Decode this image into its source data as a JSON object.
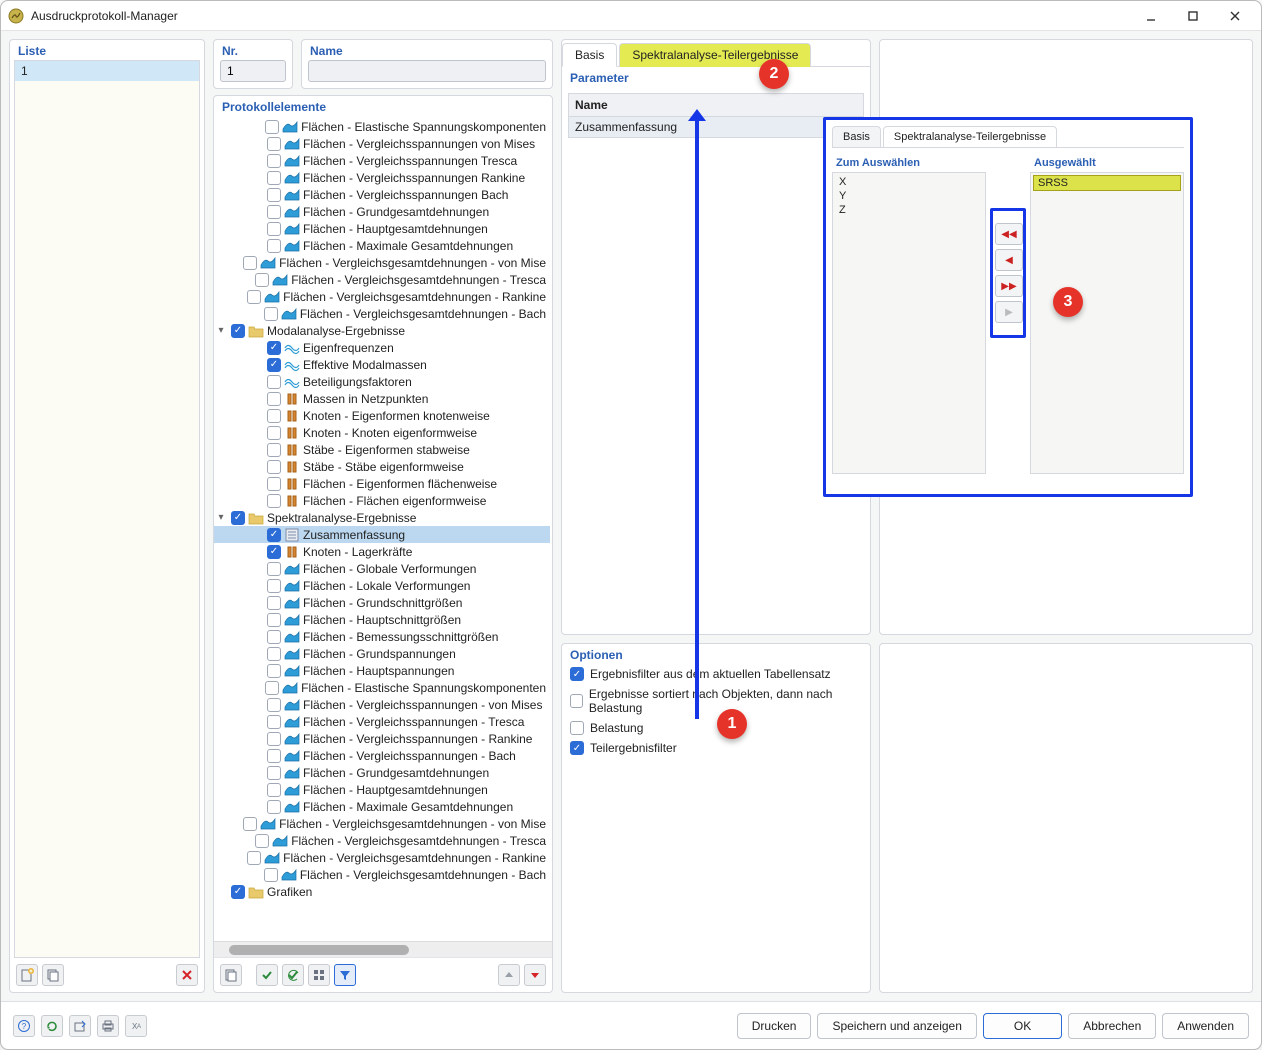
{
  "window": {
    "title": "Ausdruckprotokoll-Manager"
  },
  "leftPanel": {
    "header": "Liste",
    "items": [
      "1"
    ]
  },
  "mid": {
    "nr": {
      "label": "Nr.",
      "value": "1"
    },
    "name": {
      "label": "Name",
      "value": ""
    },
    "protokollHeader": "Protokollelemente"
  },
  "tree": [
    {
      "ind": 2,
      "chk": false,
      "icon": "surf",
      "label": "Flächen - Elastische Spannungskomponenten"
    },
    {
      "ind": 2,
      "chk": false,
      "icon": "surf",
      "label": "Flächen - Vergleichsspannungen von Mises"
    },
    {
      "ind": 2,
      "chk": false,
      "icon": "surf",
      "label": "Flächen - Vergleichsspannungen Tresca"
    },
    {
      "ind": 2,
      "chk": false,
      "icon": "surf",
      "label": "Flächen - Vergleichsspannungen Rankine"
    },
    {
      "ind": 2,
      "chk": false,
      "icon": "surf",
      "label": "Flächen - Vergleichsspannungen Bach"
    },
    {
      "ind": 2,
      "chk": false,
      "icon": "surf",
      "label": "Flächen - Grundgesamtdehnungen"
    },
    {
      "ind": 2,
      "chk": false,
      "icon": "surf",
      "label": "Flächen - Hauptgesamtdehnungen"
    },
    {
      "ind": 2,
      "chk": false,
      "icon": "surf",
      "label": "Flächen - Maximale Gesamtdehnungen"
    },
    {
      "ind": 2,
      "chk": false,
      "icon": "surf",
      "label": "Flächen - Vergleichsgesamtdehnungen - von Mise"
    },
    {
      "ind": 2,
      "chk": false,
      "icon": "surf",
      "label": "Flächen - Vergleichsgesamtdehnungen - Tresca"
    },
    {
      "ind": 2,
      "chk": false,
      "icon": "surf",
      "label": "Flächen - Vergleichsgesamtdehnungen - Rankine"
    },
    {
      "ind": 2,
      "chk": false,
      "icon": "surf",
      "label": "Flächen - Vergleichsgesamtdehnungen - Bach"
    },
    {
      "ind": 0,
      "exp": "open",
      "chk": true,
      "icon": "folder",
      "label": "Modalanalyse-Ergebnisse"
    },
    {
      "ind": 2,
      "chk": true,
      "icon": "wave",
      "label": "Eigenfrequenzen"
    },
    {
      "ind": 2,
      "chk": true,
      "icon": "wave",
      "label": "Effektive Modalmassen"
    },
    {
      "ind": 2,
      "chk": false,
      "icon": "wave",
      "label": "Beteiligungsfaktoren"
    },
    {
      "ind": 2,
      "chk": false,
      "icon": "node",
      "label": "Massen in Netzpunkten"
    },
    {
      "ind": 2,
      "chk": false,
      "icon": "node",
      "label": "Knoten - Eigenformen knotenweise"
    },
    {
      "ind": 2,
      "chk": false,
      "icon": "node",
      "label": "Knoten - Knoten eigenformweise"
    },
    {
      "ind": 2,
      "chk": false,
      "icon": "node",
      "label": "Stäbe - Eigenformen stabweise"
    },
    {
      "ind": 2,
      "chk": false,
      "icon": "node",
      "label": "Stäbe - Stäbe eigenformweise"
    },
    {
      "ind": 2,
      "chk": false,
      "icon": "node",
      "label": "Flächen - Eigenformen flächenweise"
    },
    {
      "ind": 2,
      "chk": false,
      "icon": "node",
      "label": "Flächen - Flächen eigenformweise"
    },
    {
      "ind": 0,
      "exp": "open",
      "chk": true,
      "icon": "folder",
      "label": "Spektralanalyse-Ergebnisse"
    },
    {
      "ind": 2,
      "chk": true,
      "icon": "page",
      "label": "Zusammenfassung",
      "sel": true
    },
    {
      "ind": 2,
      "chk": true,
      "icon": "node",
      "label": "Knoten - Lagerkräfte"
    },
    {
      "ind": 2,
      "chk": false,
      "icon": "surf",
      "label": "Flächen - Globale Verformungen"
    },
    {
      "ind": 2,
      "chk": false,
      "icon": "surf",
      "label": "Flächen - Lokale Verformungen"
    },
    {
      "ind": 2,
      "chk": false,
      "icon": "surf",
      "label": "Flächen - Grundschnittgrößen"
    },
    {
      "ind": 2,
      "chk": false,
      "icon": "surf",
      "label": "Flächen - Hauptschnittgrößen"
    },
    {
      "ind": 2,
      "chk": false,
      "icon": "surf",
      "label": "Flächen - Bemessungsschnittgrößen"
    },
    {
      "ind": 2,
      "chk": false,
      "icon": "surf",
      "label": "Flächen - Grundspannungen"
    },
    {
      "ind": 2,
      "chk": false,
      "icon": "surf",
      "label": "Flächen - Hauptspannungen"
    },
    {
      "ind": 2,
      "chk": false,
      "icon": "surf",
      "label": "Flächen - Elastische Spannungskomponenten"
    },
    {
      "ind": 2,
      "chk": false,
      "icon": "surf",
      "label": "Flächen - Vergleichsspannungen - von Mises"
    },
    {
      "ind": 2,
      "chk": false,
      "icon": "surf",
      "label": "Flächen - Vergleichsspannungen - Tresca"
    },
    {
      "ind": 2,
      "chk": false,
      "icon": "surf",
      "label": "Flächen - Vergleichsspannungen - Rankine"
    },
    {
      "ind": 2,
      "chk": false,
      "icon": "surf",
      "label": "Flächen - Vergleichsspannungen - Bach"
    },
    {
      "ind": 2,
      "chk": false,
      "icon": "surf",
      "label": "Flächen - Grundgesamtdehnungen"
    },
    {
      "ind": 2,
      "chk": false,
      "icon": "surf",
      "label": "Flächen - Hauptgesamtdehnungen"
    },
    {
      "ind": 2,
      "chk": false,
      "icon": "surf",
      "label": "Flächen - Maximale Gesamtdehnungen"
    },
    {
      "ind": 2,
      "chk": false,
      "icon": "surf",
      "label": "Flächen - Vergleichsgesamtdehnungen - von Mise"
    },
    {
      "ind": 2,
      "chk": false,
      "icon": "surf",
      "label": "Flächen - Vergleichsgesamtdehnungen - Tresca"
    },
    {
      "ind": 2,
      "chk": false,
      "icon": "surf",
      "label": "Flächen - Vergleichsgesamtdehnungen - Rankine"
    },
    {
      "ind": 2,
      "chk": false,
      "icon": "surf",
      "label": "Flächen - Vergleichsgesamtdehnungen - Bach"
    },
    {
      "ind": 0,
      "chk": true,
      "icon": "folder",
      "label": "Grafiken"
    }
  ],
  "detail": {
    "tabs": {
      "basis": "Basis",
      "spectral": "Spektralanalyse-Teilergebnisse"
    },
    "paramHeader": "Parameter",
    "paramNameCol": "Name",
    "paramRow": "Zusammenfassung"
  },
  "options": {
    "header": "Optionen",
    "filter": "Ergebnisfilter aus dem aktuellen Tabellensatz",
    "sort": "Ergebnisse sortiert nach Objekten, dann nach Belastung",
    "loading": "Belastung",
    "partial": "Teilergebnisfilter"
  },
  "overlay": {
    "tabs": {
      "basis": "Basis",
      "spectral": "Spektralanalyse-Teilergebnisse"
    },
    "leftHeader": "Zum Auswählen",
    "rightHeader": "Ausgewählt",
    "leftItems": [
      "X",
      "Y",
      "Z"
    ],
    "rightItems": [
      "SRSS"
    ]
  },
  "callouts": {
    "c1": "1",
    "c2": "2",
    "c3": "3"
  },
  "footer": {
    "print": "Drucken",
    "saveShow": "Speichern und anzeigen",
    "ok": "OK",
    "cancel": "Abbrechen",
    "apply": "Anwenden"
  }
}
